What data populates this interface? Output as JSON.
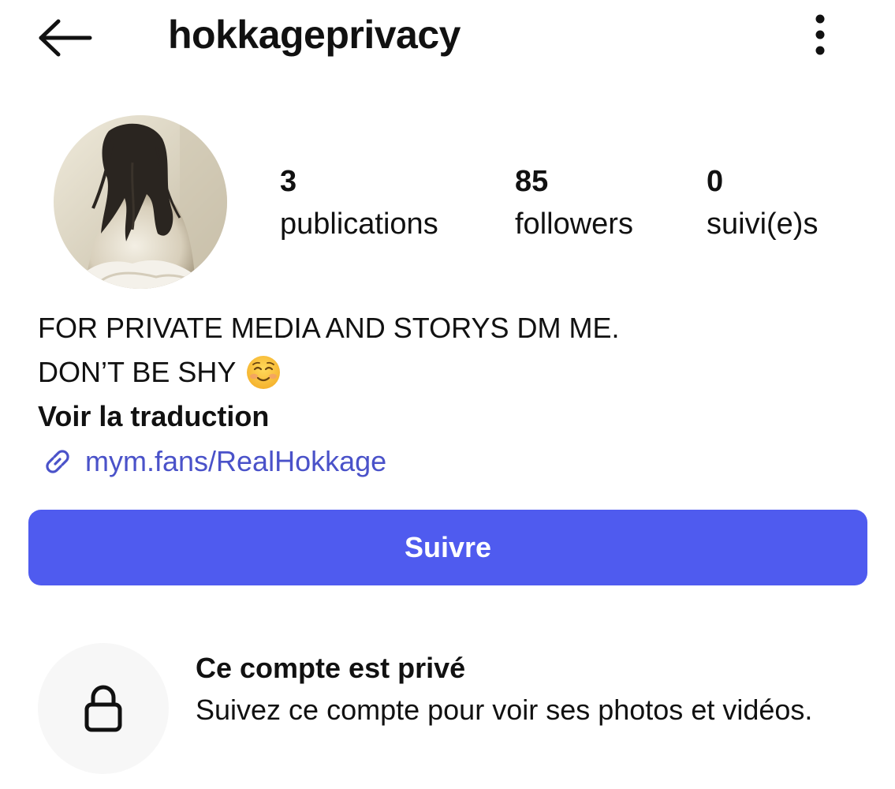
{
  "header": {
    "back_icon": "arrow-left-icon",
    "username": "hokkageprivacy",
    "more_icon": "vertical-ellipsis-icon"
  },
  "profile": {
    "avatar": "profile-photo",
    "stats": [
      {
        "count": "3",
        "label": "publications"
      },
      {
        "count": "85",
        "label": "followers"
      },
      {
        "count": "0",
        "label": "suivi(e)s"
      }
    ]
  },
  "bio": {
    "line1": "FOR PRIVATE MEDIA AND STORYS DM ME.",
    "line2": "DON’T BE SHY",
    "emoji": "smiling-face-with-blush-emoji",
    "see_translation": "Voir la traduction",
    "link_icon": "link-icon",
    "link_text": "mym.fans/RealHokkage"
  },
  "actions": {
    "follow_label": "Suivre"
  },
  "private_notice": {
    "icon": "lock-icon",
    "title": "Ce compte est privé",
    "description": "Suivez ce compte pour voir ses photos et vidéos."
  },
  "colors": {
    "accent": "#4f5bef",
    "link": "#4a52c9",
    "text": "#111111",
    "lock_bg": "#f7f7f7"
  }
}
